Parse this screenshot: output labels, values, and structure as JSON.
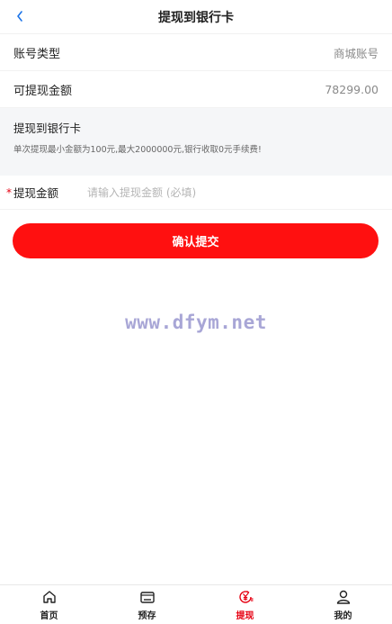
{
  "header": {
    "title": "提现到银行卡"
  },
  "rows": [
    {
      "label": "账号类型",
      "value": "商城账号"
    },
    {
      "label": "可提现金额",
      "value": "78299.00"
    }
  ],
  "info": {
    "heading": "提现到银行卡",
    "detail": "单次提现最小金额为100元,最大2000000元,银行收取0元手续费!"
  },
  "amount": {
    "required_mark": "*",
    "label": "提现金额",
    "placeholder": "请输入提现金额 (必填)"
  },
  "confirm_button": "确认提交",
  "watermark": "www.dfym.net",
  "tabbar": [
    {
      "label": "首页",
      "icon": "home-icon",
      "active": false
    },
    {
      "label": "预存",
      "icon": "wallet-icon",
      "active": false
    },
    {
      "label": "提现",
      "icon": "yuan-exchange-icon",
      "active": true
    },
    {
      "label": "我的",
      "icon": "user-icon",
      "active": false
    }
  ],
  "colors": {
    "accent": "#ff1010",
    "active_tab": "#e60012",
    "info_bg": "#f5f6f8"
  }
}
